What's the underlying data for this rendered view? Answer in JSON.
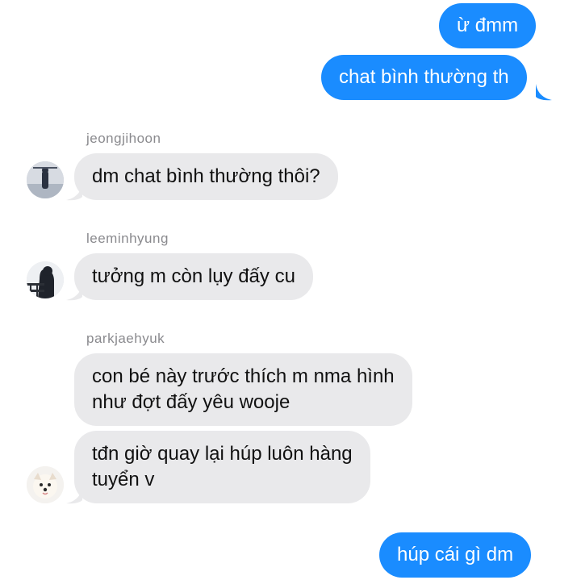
{
  "colors": {
    "outgoing_bubble": "#1a8cff",
    "incoming_bubble": "#e9e9eb",
    "sender_name": "#8a8a8e"
  },
  "messages": [
    {
      "direction": "out",
      "text": "ừ đmm"
    },
    {
      "direction": "out",
      "text": "chat bình thường th"
    },
    {
      "direction": "in",
      "sender": "jeongjihoon",
      "avatar": "avatar-jeongjihoon",
      "text": "dm chat bình thường thôi?"
    },
    {
      "direction": "in",
      "sender": "leeminhyung",
      "avatar": "avatar-leeminhyung",
      "text": "tưởng m còn lụy đấy cu"
    },
    {
      "direction": "in",
      "sender": "parkjaehyuk",
      "avatar": null,
      "lines": [
        "con bé này trước thích m nma hình",
        "như đợt đấy yêu wooje"
      ]
    },
    {
      "direction": "in",
      "sender": null,
      "avatar": "avatar-parkjaehyuk",
      "lines": [
        "tđn giờ quay lại húp luôn hàng",
        "tuyển v"
      ]
    },
    {
      "direction": "out",
      "text": "húp cái gì dm"
    }
  ]
}
